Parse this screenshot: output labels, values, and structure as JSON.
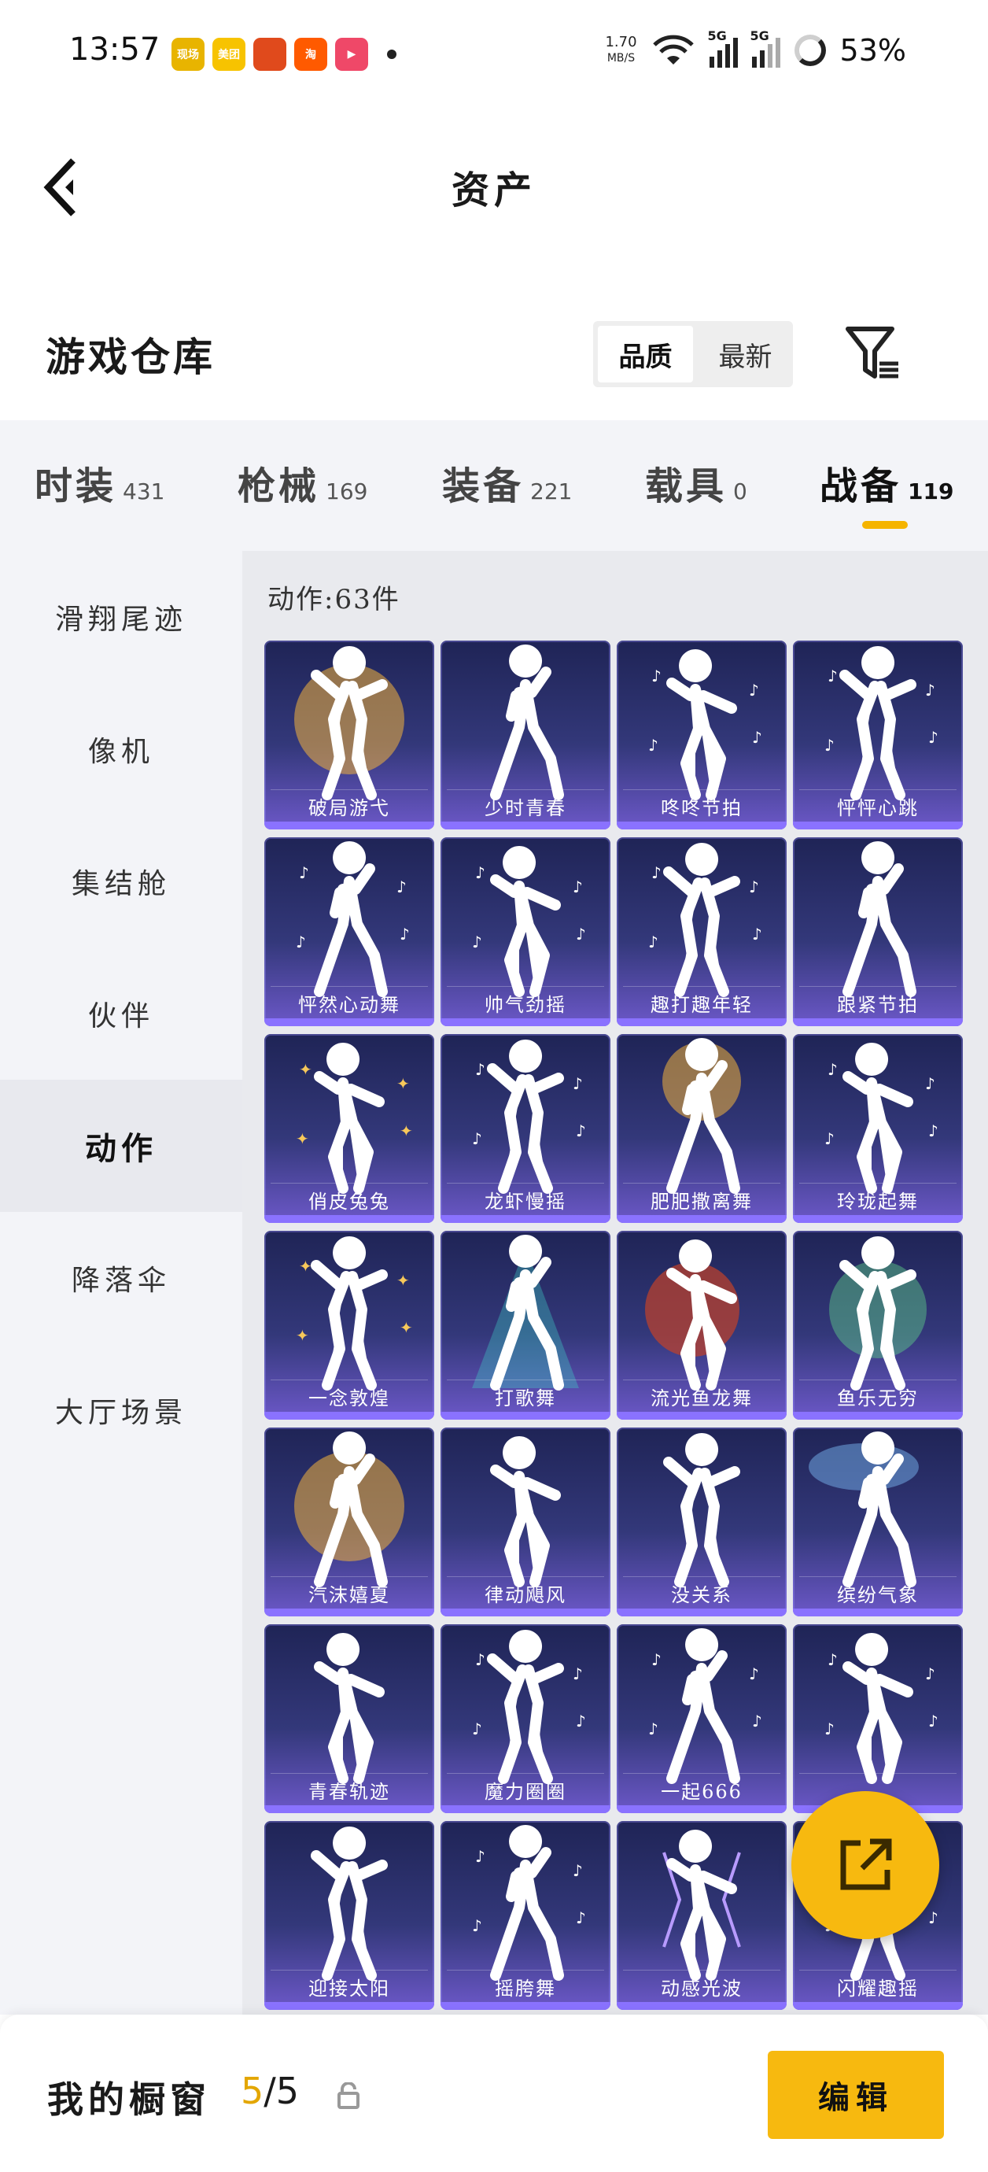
{
  "status_bar": {
    "time": "13:57",
    "app_icons": [
      {
        "name": "app-icon-1",
        "label": "现场",
        "color": "#e8b400"
      },
      {
        "name": "meituan-icon",
        "label": "美团",
        "color": "#f7c300"
      },
      {
        "name": "app-icon-3",
        "label": "",
        "color": "#e04a1c"
      },
      {
        "name": "taobao-icon",
        "label": "淘",
        "color": "#ff5a00"
      },
      {
        "name": "video-icon",
        "label": "▶",
        "color": "#ef4868"
      }
    ],
    "net_speed_value": "1.70",
    "net_speed_unit": "MB/S",
    "signal_label_1": "5G",
    "signal_label_2": "5G",
    "battery": "53%"
  },
  "header": {
    "title": "资产"
  },
  "warehouse": {
    "title": "游戏仓库",
    "sort_options": [
      "品质",
      "最新"
    ],
    "active_sort": "品质"
  },
  "tabs": [
    {
      "label": "时装",
      "count": "431"
    },
    {
      "label": "枪械",
      "count": "169"
    },
    {
      "label": "装备",
      "count": "221"
    },
    {
      "label": "载具",
      "count": "0"
    },
    {
      "label": "战备",
      "count": "119"
    }
  ],
  "active_tab": "战备",
  "sidebar": [
    {
      "label": "滑翔尾迹"
    },
    {
      "label": "像机"
    },
    {
      "label": "集结舱"
    },
    {
      "label": "伙伴"
    },
    {
      "label": "动作"
    },
    {
      "label": "降落伞"
    },
    {
      "label": "大厅场景"
    }
  ],
  "active_sidebar": "动作",
  "content": {
    "count_label": "动作:63件",
    "items": [
      {
        "name": "破局游弋",
        "effect": "wings"
      },
      {
        "name": "少时青春",
        "effect": "none"
      },
      {
        "name": "咚咚节拍",
        "effect": "notes"
      },
      {
        "name": "怦怦心跳",
        "effect": "notes"
      },
      {
        "name": "怦然心动舞",
        "effect": "notes"
      },
      {
        "name": "帅气劲摇",
        "effect": "notes"
      },
      {
        "name": "趣打趣年轻",
        "effect": "notes"
      },
      {
        "name": "跟紧节拍",
        "effect": "none"
      },
      {
        "name": "俏皮兔兔",
        "effect": "sparkle"
      },
      {
        "name": "龙虾慢摇",
        "effect": "notes"
      },
      {
        "name": "肥肥撒离舞",
        "effect": "firework"
      },
      {
        "name": "玲珑起舞",
        "effect": "notes"
      },
      {
        "name": "一念敦煌",
        "effect": "sparkle"
      },
      {
        "name": "打歌舞",
        "effect": "stage"
      },
      {
        "name": "流光鱼龙舞",
        "effect": "fire"
      },
      {
        "name": "鱼乐无穷",
        "effect": "splash"
      },
      {
        "name": "汽沫嬉夏",
        "effect": "glow"
      },
      {
        "name": "律动飓风",
        "effect": "none"
      },
      {
        "name": "没关系",
        "effect": "none"
      },
      {
        "name": "缤纷气象",
        "effect": "cloud"
      },
      {
        "name": "青春轨迹",
        "effect": "none"
      },
      {
        "name": "魔力圈圈",
        "effect": "notes"
      },
      {
        "name": "一起666",
        "effect": "notes"
      },
      {
        "name": "",
        "effect": "notes"
      },
      {
        "name": "迎接太阳",
        "effect": "none"
      },
      {
        "name": "摇胯舞",
        "effect": "notes"
      },
      {
        "name": "动感光波",
        "effect": "lightning"
      },
      {
        "name": "闪耀趣摇",
        "effect": "notes"
      }
    ]
  },
  "bottom_bar": {
    "label": "我的橱窗",
    "current": "5",
    "separator": "/",
    "total": "5",
    "edit_label": "编辑"
  },
  "colors": {
    "accent": "#f7b90f",
    "card_top": "#1f2456",
    "card_bottom": "#6c58c8"
  }
}
